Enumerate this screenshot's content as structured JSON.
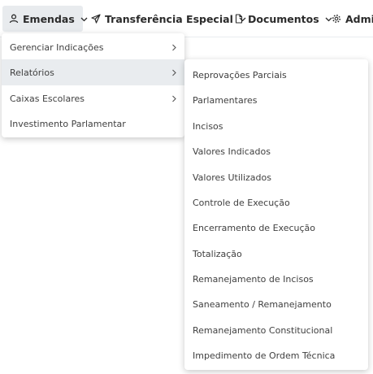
{
  "nav": {
    "items": [
      {
        "label": "Emendas",
        "icon": "user-icon"
      },
      {
        "label": "Transferência Especial",
        "icon": "send-icon"
      },
      {
        "label": "Documentos",
        "icon": "file-icon"
      },
      {
        "label": "Admin",
        "icon": "gear-icon"
      }
    ]
  },
  "menu": {
    "items": [
      {
        "label": "Gerenciar Indicações",
        "has_submenu": true
      },
      {
        "label": "Relatórios",
        "has_submenu": true
      },
      {
        "label": "Caixas Escolares",
        "has_submenu": true
      },
      {
        "label": "Investimento Parlamentar",
        "has_submenu": false
      }
    ]
  },
  "submenu": {
    "items": [
      {
        "label": "Reprovações Parciais"
      },
      {
        "label": "Parlamentares"
      },
      {
        "label": "Incisos"
      },
      {
        "label": "Valores Indicados"
      },
      {
        "label": "Valores Utilizados"
      },
      {
        "label": "Controle de Execução"
      },
      {
        "label": "Encerramento de Execução"
      },
      {
        "label": "Totalização"
      },
      {
        "label": "Remanejamento de Incisos"
      },
      {
        "label": "Saneamento / Remanejamento"
      },
      {
        "label": "Remanejamento Constitucional"
      },
      {
        "label": "Impedimento de Ordem Técnica"
      }
    ]
  },
  "colors": {
    "active_bg": "#e8ebee",
    "hover_bg": "#e9ecef",
    "text": "#404040"
  }
}
